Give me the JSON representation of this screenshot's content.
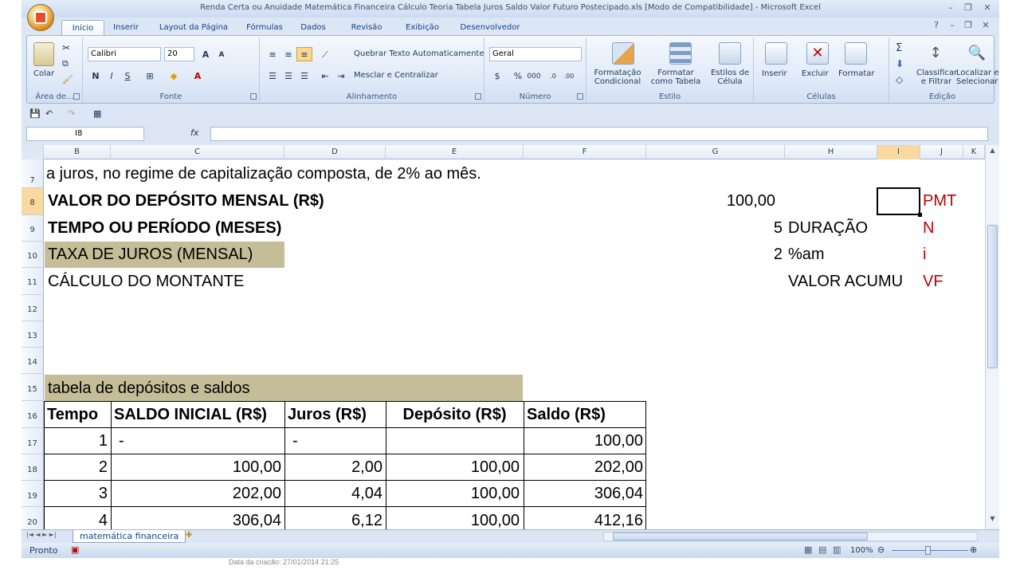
{
  "window": {
    "title": "Renda Certa ou Anuidade Matemática Financeira Cálculo Teoria Tabela Juros Saldo Valor Futuro Postecipado.xls  [Modo de Compatibilidade] - Microsoft Excel"
  },
  "tabs": [
    "Início",
    "Inserir",
    "Layout da Página",
    "Fórmulas",
    "Dados",
    "Revisão",
    "Exibição",
    "Desenvolvedor"
  ],
  "ribbon": {
    "clipboard": {
      "paste": "Colar",
      "label": "Área de..."
    },
    "font": {
      "name": "Calibri",
      "size": "20",
      "bold": "N",
      "italic": "I",
      "underline": "S",
      "label": "Fonte"
    },
    "alignment": {
      "wrap": "Quebrar Texto Automaticamente",
      "merge": "Mesclar e Centralizar",
      "label": "Alinhamento"
    },
    "number": {
      "format": "Geral",
      "percent": "%",
      "thousands": "000",
      "label": "Número"
    },
    "styles": {
      "conditional": "Formatação\nCondicional",
      "as_table": "Formatar\ncomo Tabela",
      "cell_styles": "Estilos de\nCélula",
      "label": "Estilo"
    },
    "cells": {
      "insert": "Inserir",
      "delete": "Excluir",
      "format": "Formatar",
      "label": "Células"
    },
    "editing": {
      "sigma": "Σ",
      "sort": "Classificar\ne Filtrar",
      "find": "Localizar e\nSelecionar",
      "label": "Edição"
    }
  },
  "formula_bar": {
    "name_box": "I8",
    "fx": "fx",
    "formula": ""
  },
  "columns": [
    "B",
    "C",
    "D",
    "E",
    "F",
    "G",
    "H",
    "I",
    "J",
    "K"
  ],
  "rows": [
    "7",
    "8",
    "9",
    "10",
    "11",
    "12",
    "13",
    "14",
    "15",
    "16",
    "17",
    "18",
    "19",
    "20"
  ],
  "cells": {
    "r7": "a juros, no regime de capitalização composta, de 2% ao mês.",
    "r8_label": "VALOR DO DEPÓSITO MENSAL (R$)",
    "r8_value": "100,00",
    "r8_code": "PMT",
    "r9_label": "TEMPO OU PERÍODO (MESES)",
    "r9_value": "5",
    "r9_desc": "DURAÇÃO",
    "r9_code": "N",
    "r10_label": "TAXA DE JUROS (MENSAL)",
    "r10_value": "2",
    "r10_desc": "%am",
    "r10_code": "i",
    "r11_label": "CÁLCULO DO MONTANTE",
    "r11_desc": "VALOR ACUMU",
    "r11_code": "VF",
    "r15": "tabela de depósitos e saldos"
  },
  "table": {
    "headers": [
      "Tempo",
      "SALDO INICIAL (R$)",
      "Juros (R$)",
      "Depósito (R$)",
      "Saldo (R$)"
    ],
    "rows": [
      [
        "1",
        "-",
        "-",
        "",
        "100,00"
      ],
      [
        "2",
        "100,00",
        "2,00",
        "100,00",
        "202,00"
      ],
      [
        "3",
        "202,00",
        "4,04",
        "100,00",
        "306,04"
      ],
      [
        "4",
        "306,04",
        "6,12",
        "100,00",
        "412,16"
      ]
    ]
  },
  "sheet_tab": "matemática financeira",
  "status": {
    "mode": "Pronto",
    "zoom": "100%",
    "footnote": "Data da criação: 27/01/2014 21:25"
  },
  "colors": {
    "title_blue": "#15428b",
    "header_fill": "#c4bd97",
    "code_red": "#c00000"
  }
}
